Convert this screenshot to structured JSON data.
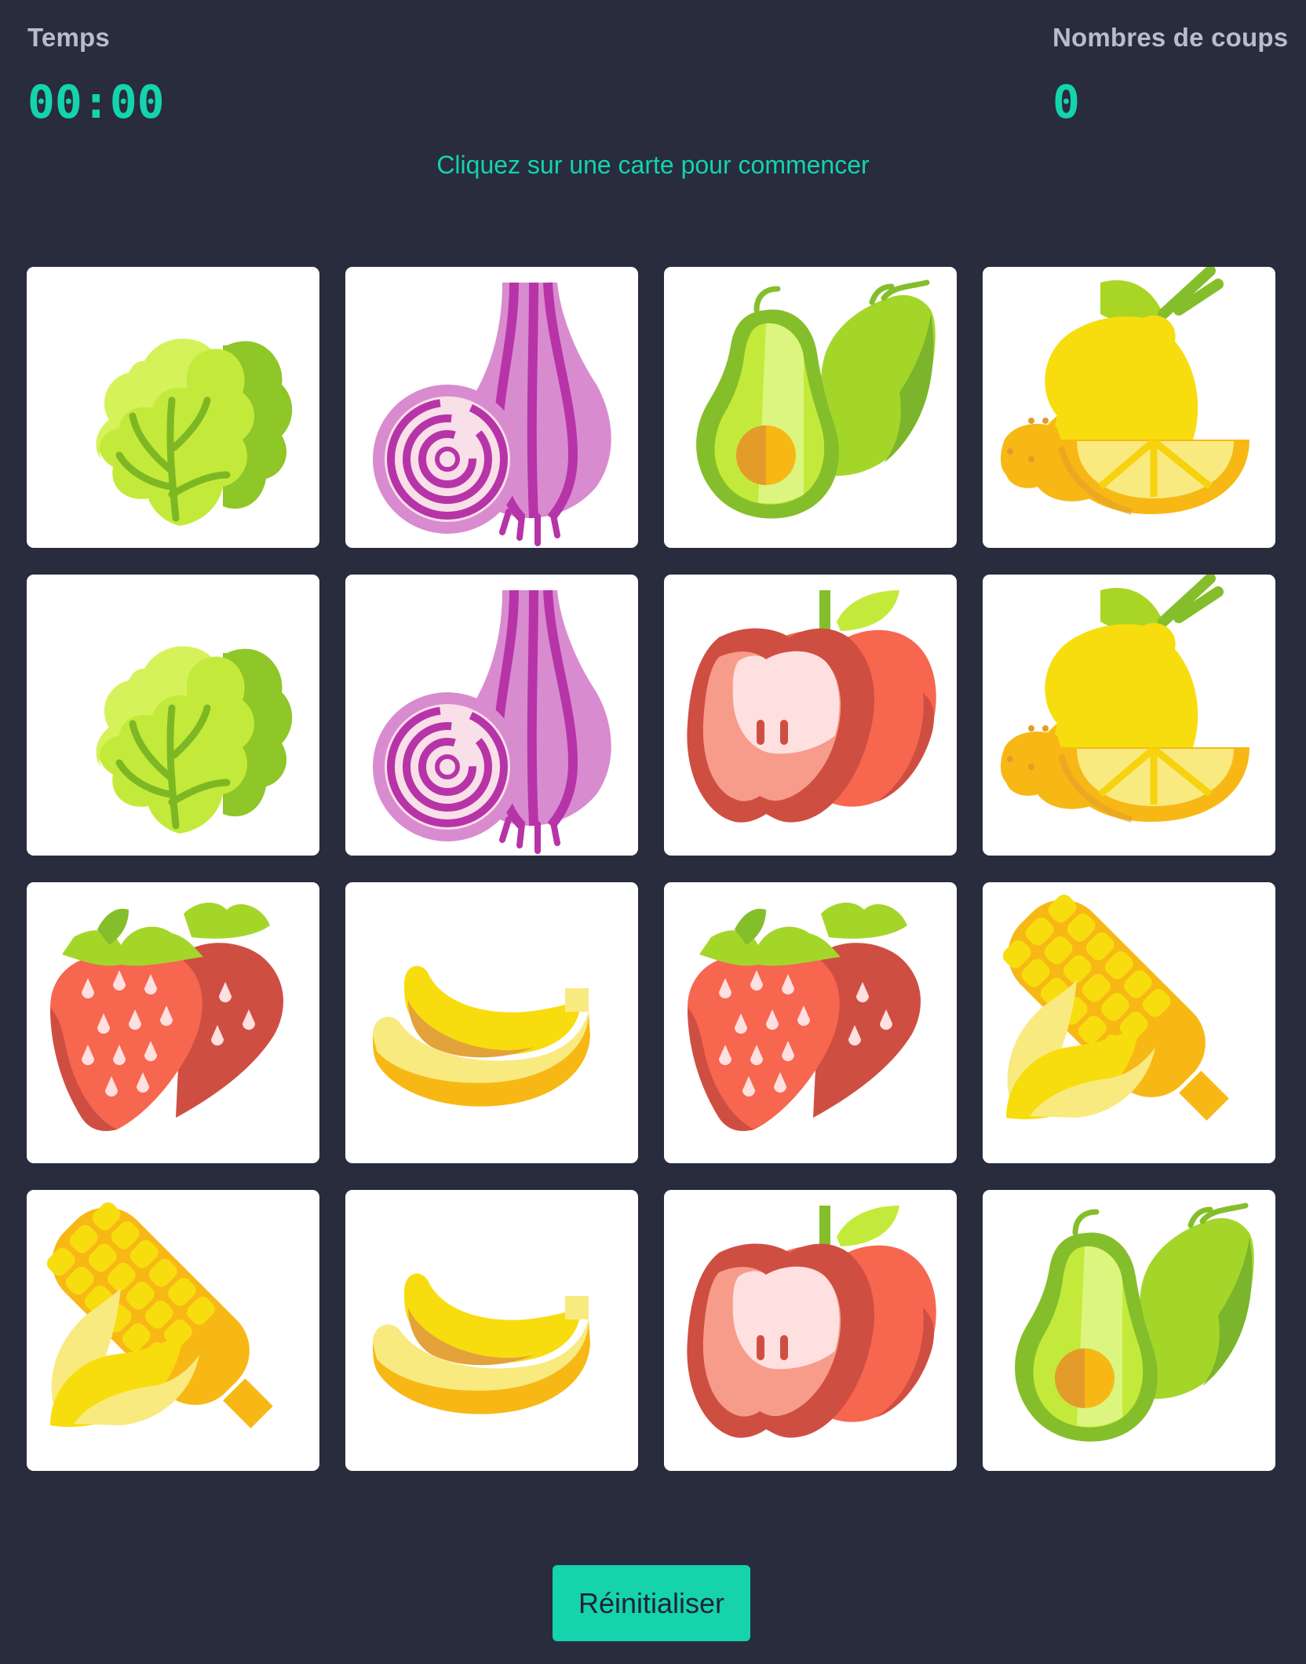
{
  "stats": {
    "time_label": "Temps",
    "time_value": "00:00",
    "moves_label": "Nombres de coups",
    "moves_value": "0"
  },
  "hint": "Cliquez sur une carte pour commencer",
  "cards": [
    {
      "fruit": "lettuce-icon"
    },
    {
      "fruit": "onion-icon"
    },
    {
      "fruit": "avocado-icon"
    },
    {
      "fruit": "lemon-icon"
    },
    {
      "fruit": "lettuce-icon"
    },
    {
      "fruit": "onion-icon"
    },
    {
      "fruit": "apple-icon"
    },
    {
      "fruit": "lemon-icon"
    },
    {
      "fruit": "strawberry-icon"
    },
    {
      "fruit": "banana-icon"
    },
    {
      "fruit": "strawberry-icon"
    },
    {
      "fruit": "corn-icon"
    },
    {
      "fruit": "corn-icon"
    },
    {
      "fruit": "banana-icon"
    },
    {
      "fruit": "apple-icon"
    },
    {
      "fruit": "avocado-icon"
    }
  ],
  "reset_label": "Réinitialiser",
  "colors": {
    "background": "#282c3d",
    "accent": "#14d3ad",
    "label": "#b8bccb",
    "card": "#ffffff"
  }
}
